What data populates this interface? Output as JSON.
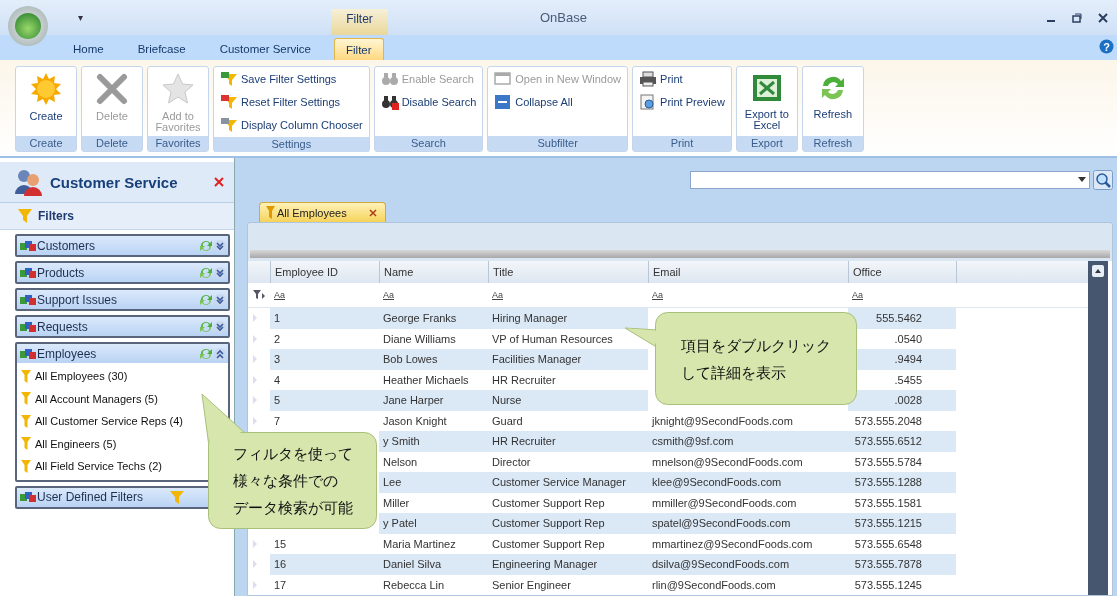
{
  "window": {
    "title": "OnBase",
    "context_tab": "Filter",
    "menu_glyph": "▾",
    "help_glyph": "?"
  },
  "ribbon_tabs": [
    {
      "label": "Home",
      "selected": false
    },
    {
      "label": "Briefcase",
      "selected": false
    },
    {
      "label": "Customer Service",
      "selected": false
    },
    {
      "label": "Filter",
      "selected": true
    }
  ],
  "ribbon_groups": [
    {
      "label": "Create",
      "buttons": [
        {
          "label": "Create",
          "kind": "large",
          "disabled": false
        }
      ]
    },
    {
      "label": "Delete",
      "buttons": [
        {
          "label": "Delete",
          "kind": "large",
          "disabled": true
        }
      ]
    },
    {
      "label": "Favorites",
      "buttons": [
        {
          "label": "Add to Favorites",
          "kind": "large",
          "disabled": true
        }
      ]
    },
    {
      "label": "Settings",
      "buttons": [
        {
          "label": "Save Filter Settings",
          "kind": "small",
          "disabled": false
        },
        {
          "label": "Reset Filter Settings",
          "kind": "small",
          "disabled": false
        },
        {
          "label": "Display Column Chooser",
          "kind": "small",
          "disabled": false
        }
      ]
    },
    {
      "label": "Search",
      "buttons": [
        {
          "label": "Enable Search",
          "kind": "small",
          "disabled": true
        },
        {
          "label": "Disable Search",
          "kind": "small",
          "disabled": false
        }
      ]
    },
    {
      "label": "Subfilter",
      "buttons": [
        {
          "label": "Open in New Window",
          "kind": "small",
          "disabled": true
        },
        {
          "label": "Collapse All",
          "kind": "small",
          "disabled": false
        }
      ]
    },
    {
      "label": "Print",
      "buttons": [
        {
          "label": "Print",
          "kind": "small",
          "disabled": false
        },
        {
          "label": "Print Preview",
          "kind": "small",
          "disabled": false
        }
      ]
    },
    {
      "label": "Export",
      "buttons": [
        {
          "label": "Export to Excel",
          "kind": "large",
          "disabled": false
        }
      ]
    },
    {
      "label": "Refresh",
      "buttons": [
        {
          "label": "Refresh",
          "kind": "large",
          "disabled": false
        }
      ]
    }
  ],
  "sidebar": {
    "title": "Customer Service",
    "filters_label": "Filters",
    "sections": [
      {
        "label": "Customers",
        "kind": "group",
        "expanded": false
      },
      {
        "label": "Products",
        "kind": "group",
        "expanded": false
      },
      {
        "label": "Support Issues",
        "kind": "group",
        "expanded": false
      },
      {
        "label": "Requests",
        "kind": "group",
        "expanded": false
      },
      {
        "label": "Employees",
        "kind": "group",
        "expanded": true,
        "items": [
          "All Employees (30)",
          "All Account Managers (5)",
          "All Customer Service Reps (4)",
          "All Engineers (5)",
          "All Field Service Techs (2)"
        ]
      },
      {
        "label": "User Defined Filters",
        "kind": "user",
        "expanded": false
      }
    ]
  },
  "document_tab": {
    "label": "All Employees"
  },
  "table": {
    "columns": [
      "Employee ID",
      "Name",
      "Title",
      "Email",
      "Office"
    ],
    "filter_row": [
      "Aa",
      "Aa",
      "Aa",
      "Aa",
      "Aa"
    ],
    "rows": [
      {
        "id": "1",
        "name": "George Franks",
        "title": "Hiring Manager",
        "office": "555.5462"
      },
      {
        "id": "2",
        "name": "Diane Williams",
        "title": "VP of Human Resources",
        "office": ".0540"
      },
      {
        "id": "3",
        "name": "Bob Lowes",
        "title": "Facilities Manager",
        "office": ".9494"
      },
      {
        "id": "4",
        "name": "Heather Michaels",
        "title": "HR Recruiter",
        "office": ".5455"
      },
      {
        "id": "5",
        "name": "Jane Harper",
        "title": "Nurse",
        "office": ".0028"
      },
      {
        "id": "7",
        "name": "Jason Knight",
        "title": "Guard",
        "email": "jknight@9SecondFoods.com",
        "office": "573.555.2048"
      },
      {
        "name": "y Smith",
        "title": "HR Recruiter",
        "email": "csmith@9sf.com",
        "office": "573.555.6512"
      },
      {
        "name": "Nelson",
        "title": "Director",
        "email": "mnelson@9SecondFoods.com",
        "office": "573.555.5784"
      },
      {
        "name": "Lee",
        "title": "Customer Service Manager",
        "email": "klee@9SecondFoods.com",
        "office": "573.555.1288"
      },
      {
        "name": "Miller",
        "title": "Customer Support Rep",
        "email": "mmiller@9SecondFoods.com",
        "office": "573.555.1581"
      },
      {
        "name": "y Patel",
        "title": "Customer Support Rep",
        "email": "spatel@9SecondFoods.com",
        "office": "573.555.1215"
      },
      {
        "id": "15",
        "name": "Maria Martinez",
        "title": "Customer Support Rep",
        "email": "mmartinez@9SecondFoods.com",
        "office": "573.555.6548"
      },
      {
        "id": "16",
        "name": "Daniel Silva",
        "title": "Engineering Manager",
        "email": "dsilva@9SecondFoods.com",
        "office": "573.555.7878"
      },
      {
        "id": "17",
        "name": "Rebecca Lin",
        "title": "Senior Engineer",
        "email": "rlin@9SecondFoods.com",
        "office": "573.555.1245"
      }
    ]
  },
  "callouts": [
    {
      "lines": [
        "項目をダブルクリック",
        "して詳細を表示"
      ]
    },
    {
      "lines": [
        "フィルタを使って",
        "様々な条件での",
        "データ検索が可能"
      ]
    }
  ]
}
